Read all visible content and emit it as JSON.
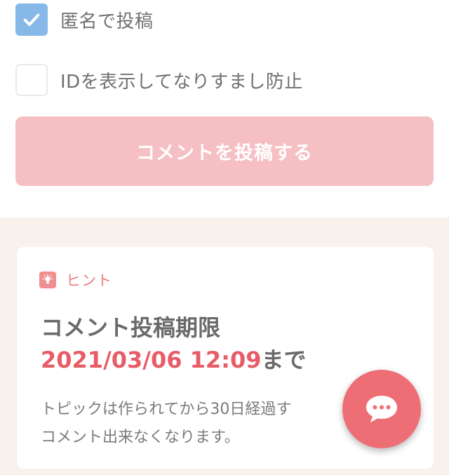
{
  "form": {
    "anonymous_label": "匿名で投稿",
    "anonymous_checked": true,
    "show_id_label": "IDを表示してなりすまし防止",
    "show_id_checked": false,
    "submit_label": "コメントを投稿する"
  },
  "hint": {
    "header": "ヒント",
    "deadline_title": "コメント投稿期限",
    "deadline_date": "2021/03/06 12:09",
    "deadline_suffix": "まで",
    "body_line1": "トピックは作られてから30日経過す",
    "body_line2": "コメント出来なくなります。"
  },
  "colors": {
    "accent": "#ee6e76",
    "submit_disabled": "#f6bfc3",
    "checkbox_checked": "#86b8e8",
    "deadline_red": "#e75c66",
    "page_bg": "#f9f1ec"
  },
  "icons": {
    "checkbox_check": "check-icon",
    "hint": "lightbulb-icon",
    "chat_fab": "chat-bubble-icon"
  }
}
